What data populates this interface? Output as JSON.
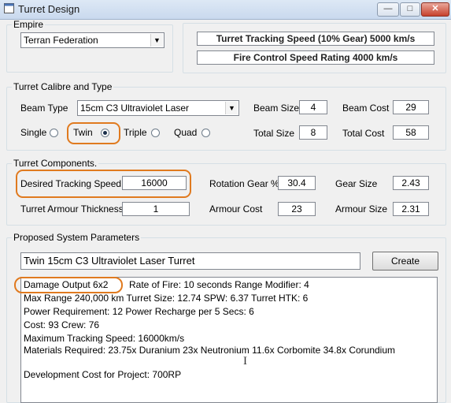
{
  "window": {
    "title": "Turret Design",
    "btn_minimize": "—",
    "btn_maximize": "□",
    "btn_close": "✕"
  },
  "empire": {
    "legend": "Empire",
    "selected": "Terran Federation",
    "tracking_speed_text": "Turret Tracking Speed (10% Gear) 5000 km/s",
    "fire_control_text": "Fire Control Speed Rating 4000 km/s"
  },
  "calibre": {
    "legend": "Turret Calibre and Type",
    "beam_type_label": "Beam Type",
    "beam_type_value": "15cm C3 Ultraviolet Laser",
    "beam_size_label": "Beam Size",
    "beam_size_value": "4",
    "beam_cost_label": "Beam Cost",
    "beam_cost_value": "29",
    "total_size_label": "Total Size",
    "total_size_value": "8",
    "total_cost_label": "Total Cost",
    "total_cost_value": "58",
    "options": {
      "single": "Single",
      "twin": "Twin",
      "triple": "Triple",
      "quad": "Quad"
    },
    "selected_option": "Twin"
  },
  "components": {
    "legend": "Turret Components.",
    "desired_speed_label": "Desired Tracking Speed",
    "desired_speed_value": "16000",
    "rotation_gear_label": "Rotation Gear %",
    "rotation_gear_value": "30.4",
    "gear_size_label": "Gear Size",
    "gear_size_value": "2.43",
    "armour_thickness_label": "Turret Armour Thickness",
    "armour_thickness_value": "1",
    "armour_cost_label": "Armour Cost",
    "armour_cost_value": "23",
    "armour_size_label": "Armour Size",
    "armour_size_value": "2.31"
  },
  "proposed": {
    "legend": "Proposed System Parameters",
    "name_value": "Twin 15cm C3 Ultraviolet Laser Turret",
    "create_label": "Create",
    "details": {
      "damage_output": "Damage Output 6x2",
      "line1_rest": "Rate of Fire: 10 seconds     Range Modifier: 4",
      "line2": "Max Range 240,000 km    Turret Size: 12.74    SPW: 6.37    Turret HTK: 6",
      "line3": "Power Requirement: 12    Power Recharge per 5 Secs: 6",
      "line4": "Cost: 93    Crew: 76",
      "line5": "Maximum Tracking Speed: 16000km/s",
      "line6": "Materials Required: 23.75x Duranium  23x Neutronium  11.6x Corbomite  34.8x Corundium",
      "line7": "Development Cost for Project: 700RP"
    }
  },
  "colors": {
    "highlight": "#e07a1f",
    "title_bar": "#c9d9ee",
    "close_button": "#c7412d"
  }
}
